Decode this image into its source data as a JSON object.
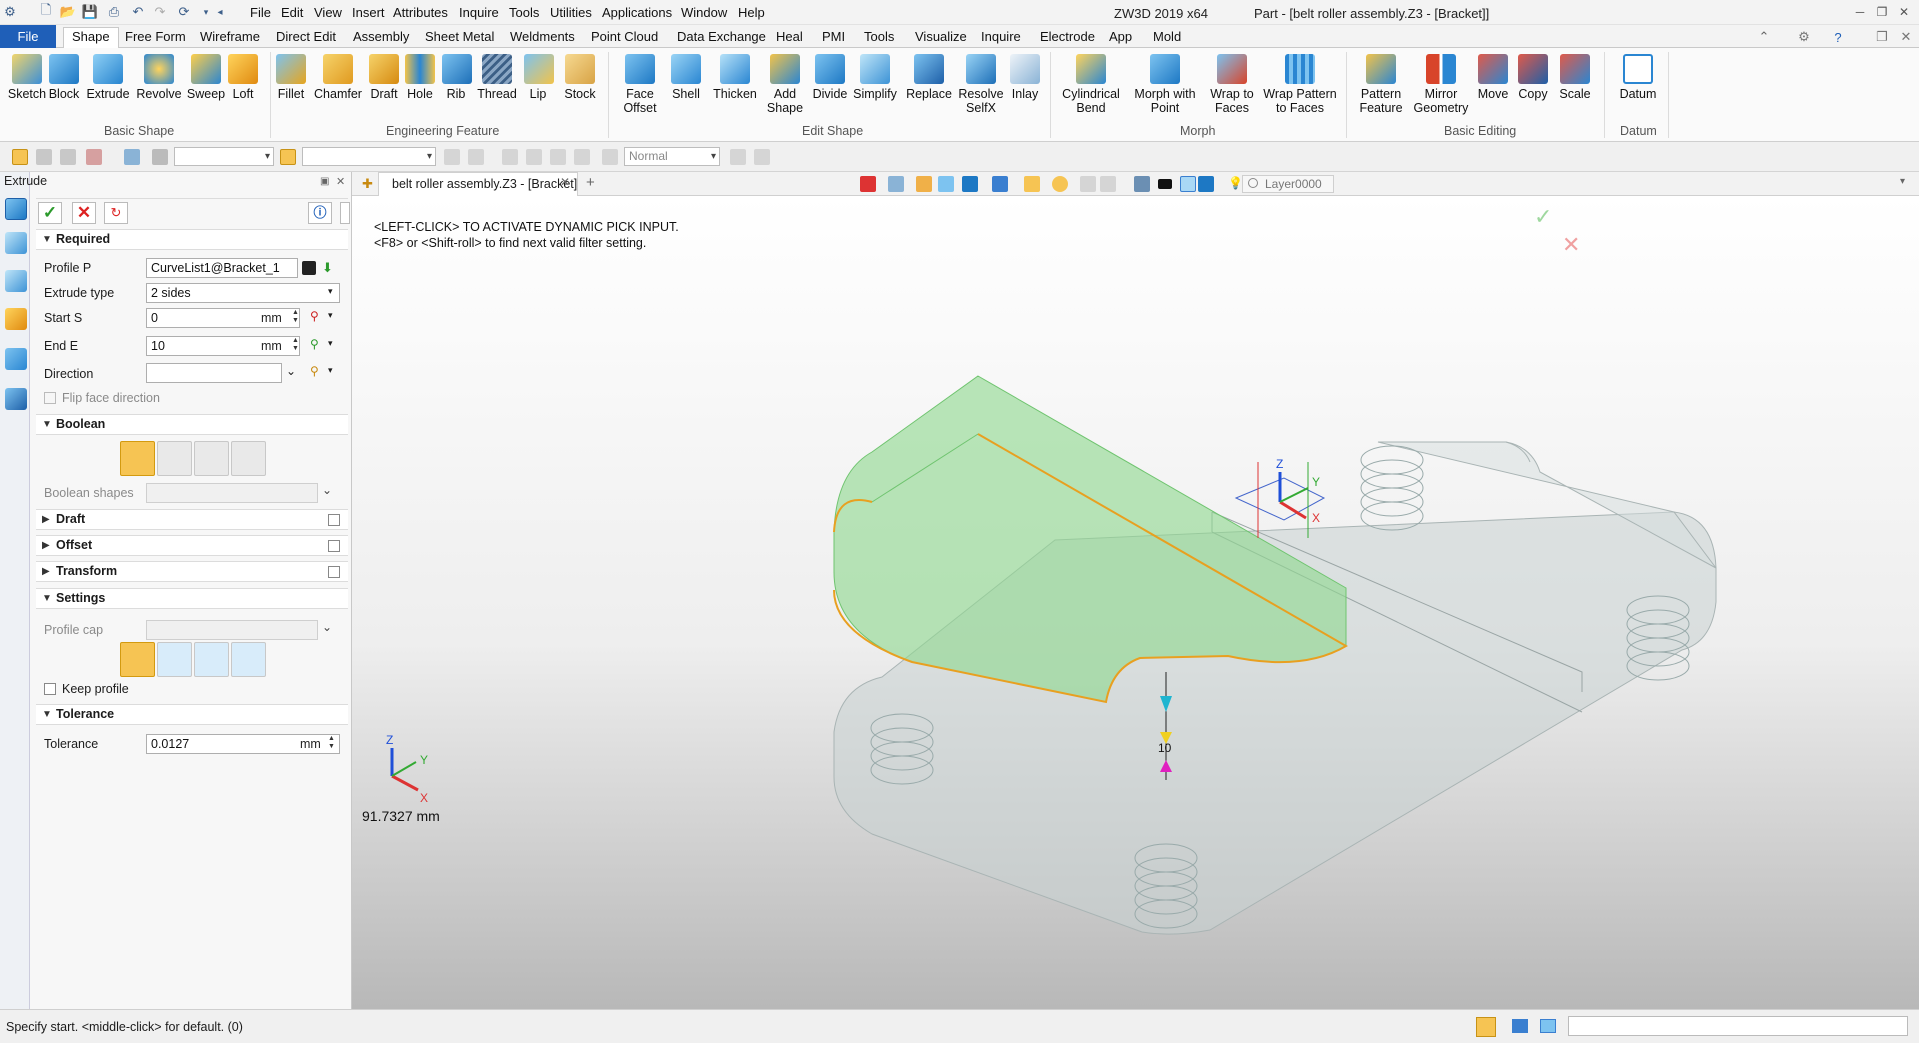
{
  "window": {
    "menu": [
      "File",
      "Edit",
      "View",
      "Insert",
      "Attributes",
      "Inquire",
      "Tools",
      "Utilities",
      "Applications",
      "Window",
      "Help"
    ],
    "app_title": "ZW3D 2019  x64",
    "doc_title": "Part - [belt roller assembly.Z3 - [Bracket]]"
  },
  "ribbon": {
    "tabs": [
      "File",
      "Shape",
      "Free Form",
      "Wireframe",
      "Direct Edit",
      "Assembly",
      "Sheet Metal",
      "Weldments",
      "Point Cloud",
      "Data Exchange",
      "Heal",
      "PMI",
      "Tools",
      "Visualize",
      "Inquire",
      "Electrode",
      "App",
      "Mold"
    ],
    "active_tab": "Shape",
    "groups": {
      "basic_shape": "Basic Shape",
      "engineering_feature": "Engineering Feature",
      "edit_shape": "Edit Shape",
      "morph": "Morph",
      "basic_editing": "Basic Editing",
      "datum": "Datum"
    },
    "buttons": {
      "sketch": "Sketch",
      "block": "Block",
      "extrude": "Extrude",
      "revolve": "Revolve",
      "sweep": "Sweep",
      "loft": "Loft",
      "fillet": "Fillet",
      "chamfer": "Chamfer",
      "draft": "Draft",
      "hole": "Hole",
      "rib": "Rib",
      "thread": "Thread",
      "lip": "Lip",
      "stock": "Stock",
      "face_offset_1": "Face",
      "face_offset_2": "Offset",
      "shell": "Shell",
      "thicken": "Thicken",
      "add_shape_1": "Add",
      "add_shape_2": "Shape",
      "divide": "Divide",
      "simplify": "Simplify",
      "replace": "Replace",
      "resolve_1": "Resolve",
      "resolve_2": "SelfX",
      "inlay": "Inlay",
      "cyl_bend_1": "Cylindrical",
      "cyl_bend_2": "Bend",
      "morph_pt_1": "Morph with",
      "morph_pt_2": "Point",
      "wrap_1": "Wrap to",
      "wrap_2": "Faces",
      "wrap_pat_1": "Wrap Pattern",
      "wrap_pat_2": "to Faces",
      "pattern_1": "Pattern",
      "pattern_2": "Feature",
      "mirror_1": "Mirror",
      "mirror_2": "Geometry",
      "move": "Move",
      "copy": "Copy",
      "scale": "Scale",
      "datum": "Datum"
    },
    "colors": {
      "file_tab": "#1f5fb8",
      "accent": "#f6c453"
    }
  },
  "toolbar2": {
    "render_mode": "Normal"
  },
  "panel": {
    "title": "Extrude",
    "required": {
      "header": "Required",
      "profile_label": "Profile P",
      "profile_value": "CurveList1@Bracket_1",
      "extrude_type_label": "Extrude type",
      "extrude_type_value": "2 sides",
      "start_label": "Start S",
      "start_value": "0",
      "start_unit": "mm",
      "end_label": "End E",
      "end_value": "10",
      "end_unit": "mm",
      "direction_label": "Direction",
      "direction_value": "",
      "flip_label": "Flip face direction"
    },
    "boolean": {
      "header": "Boolean",
      "shapes_label": "Boolean shapes"
    },
    "draft": {
      "header": "Draft"
    },
    "offset": {
      "header": "Offset"
    },
    "transform": {
      "header": "Transform"
    },
    "settings": {
      "header": "Settings",
      "profile_cap_label": "Profile cap",
      "keep_profile_label": "Keep profile"
    },
    "tolerance": {
      "header": "Tolerance",
      "label": "Tolerance",
      "value": "0.0127",
      "unit": "mm"
    }
  },
  "viewport": {
    "doc_tab": "belt roller assembly.Z3 - [Bracket]",
    "prompt_1": "<LEFT-CLICK> TO ACTIVATE DYNAMIC PICK INPUT.",
    "prompt_2": "<F8> or <Shift-roll> to find next valid filter setting.",
    "layer": "Layer0000",
    "measure": "91.7327 mm",
    "dim_value": "10",
    "axis_x": "X",
    "axis_y": "Y",
    "axis_z": "Z"
  },
  "status": {
    "text": "Specify start.  <middle-click> for default. (0)"
  }
}
